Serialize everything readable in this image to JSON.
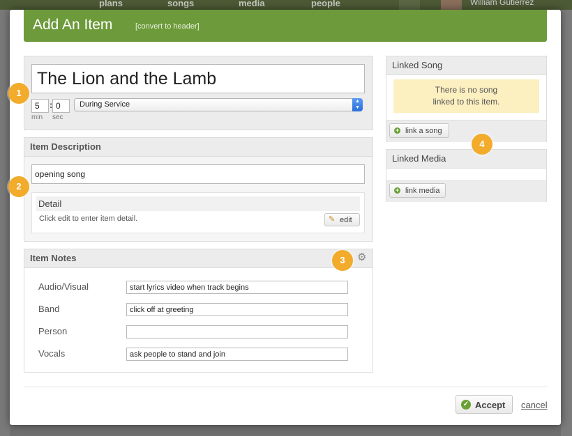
{
  "background": {
    "nav": [
      "plans",
      "songs",
      "media",
      "people"
    ],
    "user_name": "William Gutierrez"
  },
  "modal": {
    "title": "Add An Item",
    "convert_link": "[convert to header]"
  },
  "item": {
    "title": "The Lion and the Lamb",
    "minutes": "5",
    "seconds": "0",
    "min_label": "min",
    "sec_label": "sec",
    "timing": "During Service",
    "timing_options": [
      "During Service"
    ]
  },
  "description": {
    "header": "Item Description",
    "value": "opening song",
    "detail_header": "Detail",
    "detail_text": "Click edit to enter item detail.",
    "edit_label": "edit"
  },
  "notes": {
    "header": "Item Notes",
    "rows": [
      {
        "label": "Audio/Visual",
        "value": "start lyrics video when track begins"
      },
      {
        "label": "Band",
        "value": "click off at greeting"
      },
      {
        "label": "Person",
        "value": ""
      },
      {
        "label": "Vocals",
        "value": "ask people to stand and join"
      }
    ]
  },
  "linked_song": {
    "header": "Linked Song",
    "empty_line1": "There is no song",
    "empty_line2": "linked to this item.",
    "button": "link a song"
  },
  "linked_media": {
    "header": "Linked Media",
    "button": "link media"
  },
  "badges": [
    "1",
    "2",
    "3",
    "4"
  ],
  "footer": {
    "accept": "Accept",
    "cancel": "cancel"
  },
  "colors": {
    "header_green": "#6d9a3b",
    "badge_orange": "#f2ab2b",
    "notice_yellow": "#fcefc0"
  }
}
